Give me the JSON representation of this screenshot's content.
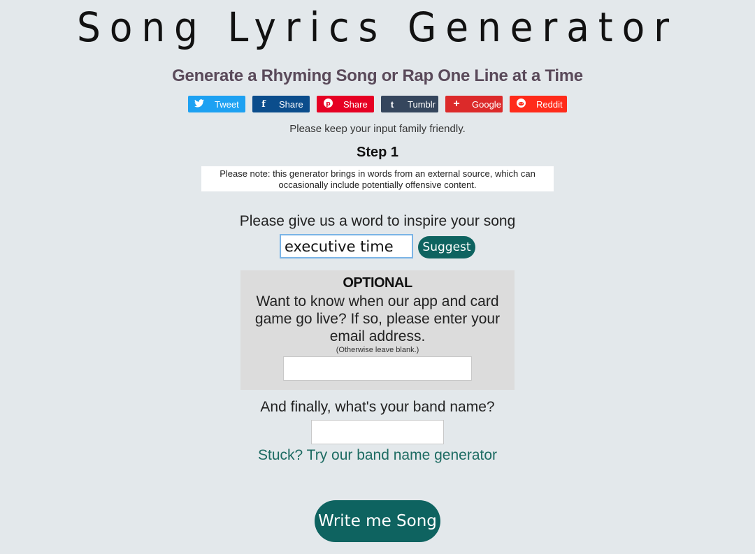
{
  "header": {
    "title": "Song Lyrics Generator",
    "subtitle": "Generate a Rhyming Song or Rap One Line at a Time"
  },
  "share_buttons": [
    {
      "label": "Tweet",
      "icon": "twitter-icon",
      "glyph": "🐦",
      "color": "#1da1f2"
    },
    {
      "label": "Share",
      "icon": "facebook-icon",
      "glyph": "f",
      "color": "#0b4d8c"
    },
    {
      "label": "Share",
      "icon": "pinterest-icon",
      "glyph": "℗",
      "color": "#e60023"
    },
    {
      "label": "Tumblr",
      "icon": "tumblr-icon",
      "glyph": "t",
      "color": "#35465d"
    },
    {
      "label": "Google",
      "icon": "google-plus-icon",
      "glyph": "+",
      "color": "#dc2a2a"
    },
    {
      "label": "Reddit",
      "icon": "reddit-icon",
      "glyph": "●",
      "color": "#ff2b1a"
    }
  ],
  "family_note": "Please keep your input family friendly.",
  "step": "Step 1",
  "content_note": "Please note: this generator brings in words from an external source, which can occasionally include potentially offensive content.",
  "inspire": {
    "label": "Please give us a word to inspire your song",
    "value": "executive time",
    "suggest_label": "Suggest"
  },
  "optional": {
    "heading": "OPTIONAL",
    "body": "Want to know when our app and card game go live? If so, please enter your email address.",
    "small": "(Otherwise leave blank.)",
    "email_value": ""
  },
  "band": {
    "label": "And finally, what's your band name?",
    "value": "",
    "link": "Stuck? Try our band name generator"
  },
  "submit_label": "Write me Song"
}
